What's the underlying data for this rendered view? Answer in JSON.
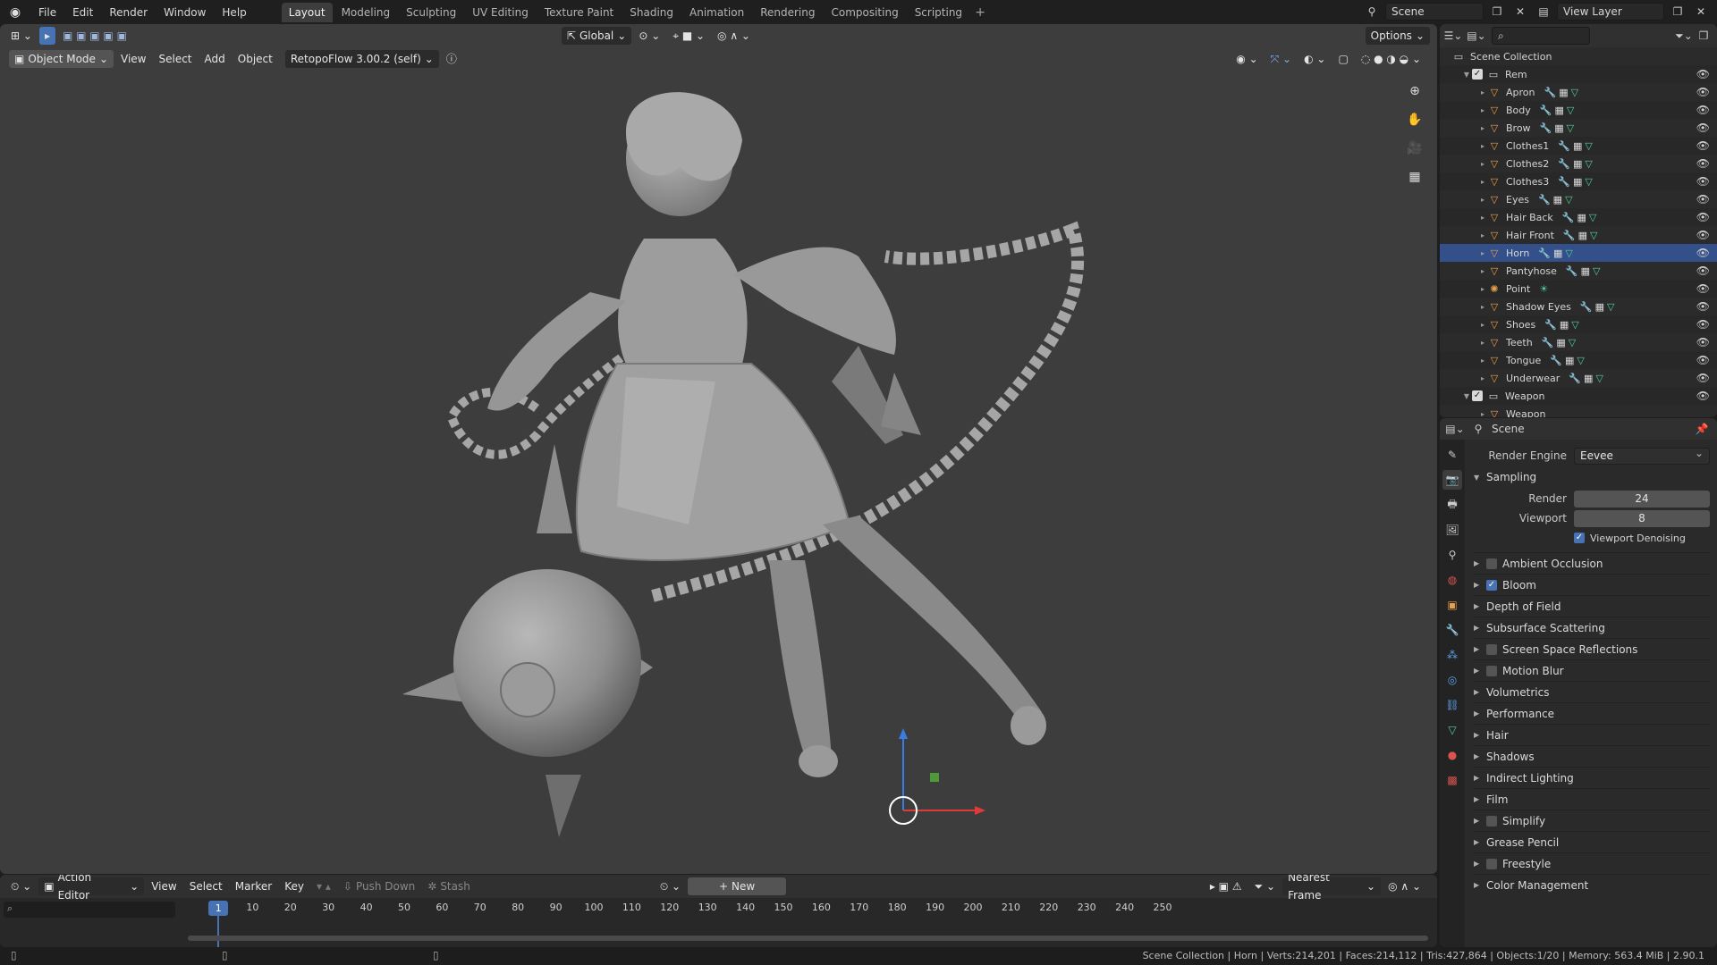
{
  "topbar": {
    "menus": [
      "File",
      "Edit",
      "Render",
      "Window",
      "Help"
    ],
    "workspaces": [
      "Layout",
      "Modeling",
      "Sculpting",
      "UV Editing",
      "Texture Paint",
      "Shading",
      "Animation",
      "Rendering",
      "Compositing",
      "Scripting"
    ],
    "active_workspace": "Layout",
    "scene_name": "Scene",
    "view_layer": "View Layer"
  },
  "viewport": {
    "mode": "Object Mode",
    "menus": [
      "View",
      "Select",
      "Add",
      "Object"
    ],
    "addon": "RetopoFlow 3.00.2 (self)",
    "orientation": "Global",
    "options_label": "Options"
  },
  "outliner": {
    "root": "Scene Collection",
    "collection": "Rem",
    "objects": [
      {
        "name": "Apron",
        "type": "mesh"
      },
      {
        "name": "Body",
        "type": "mesh"
      },
      {
        "name": "Brow",
        "type": "mesh"
      },
      {
        "name": "Clothes1",
        "type": "mesh"
      },
      {
        "name": "Clothes2",
        "type": "mesh"
      },
      {
        "name": "Clothes3",
        "type": "mesh"
      },
      {
        "name": "Eyes",
        "type": "mesh"
      },
      {
        "name": "Hair Back",
        "type": "mesh"
      },
      {
        "name": "Hair Front",
        "type": "mesh"
      },
      {
        "name": "Horn",
        "type": "mesh",
        "selected": true
      },
      {
        "name": "Pantyhose",
        "type": "mesh"
      },
      {
        "name": "Point",
        "type": "light"
      },
      {
        "name": "Shadow Eyes",
        "type": "mesh"
      },
      {
        "name": "Shoes",
        "type": "mesh"
      },
      {
        "name": "Teeth",
        "type": "mesh"
      },
      {
        "name": "Tongue",
        "type": "mesh"
      },
      {
        "name": "Underwear",
        "type": "mesh"
      }
    ],
    "collection2": "Weapon",
    "collection2_child": "Weapon"
  },
  "properties": {
    "context": "Scene",
    "render_engine_label": "Render Engine",
    "render_engine": "Eevee",
    "sampling_label": "Sampling",
    "render_label": "Render",
    "render_samples": "24",
    "viewport_label": "Viewport",
    "viewport_samples": "8",
    "viewport_denoising": "Viewport Denoising",
    "panels": [
      {
        "label": "Ambient Occlusion",
        "checkbox": true,
        "checked": false
      },
      {
        "label": "Bloom",
        "checkbox": true,
        "checked": true
      },
      {
        "label": "Depth of Field",
        "checkbox": false
      },
      {
        "label": "Subsurface Scattering",
        "checkbox": false
      },
      {
        "label": "Screen Space Reflections",
        "checkbox": true,
        "checked": false
      },
      {
        "label": "Motion Blur",
        "checkbox": true,
        "checked": false
      },
      {
        "label": "Volumetrics",
        "checkbox": false
      },
      {
        "label": "Performance",
        "checkbox": false
      },
      {
        "label": "Hair",
        "checkbox": false
      },
      {
        "label": "Shadows",
        "checkbox": false
      },
      {
        "label": "Indirect Lighting",
        "checkbox": false
      },
      {
        "label": "Film",
        "checkbox": false
      },
      {
        "label": "Simplify",
        "checkbox": true,
        "checked": false
      },
      {
        "label": "Grease Pencil",
        "checkbox": false
      },
      {
        "label": "Freestyle",
        "checkbox": true,
        "checked": false
      },
      {
        "label": "Color Management",
        "checkbox": false
      }
    ]
  },
  "timeline": {
    "editor": "Action Editor",
    "menus": [
      "View",
      "Select",
      "Marker",
      "Key"
    ],
    "push_down": "Push Down",
    "stash": "Stash",
    "new_label": "New",
    "snap": "Nearest Frame",
    "current_frame": "1",
    "ticks": [
      "10",
      "20",
      "30",
      "40",
      "50",
      "60",
      "70",
      "80",
      "90",
      "100",
      "110",
      "120",
      "130",
      "140",
      "150",
      "160",
      "170",
      "180",
      "190",
      "200",
      "210",
      "220",
      "230",
      "240",
      "250"
    ]
  },
  "statusbar": {
    "text": "Scene Collection | Horn | Verts:214,201 | Faces:214,112 | Tris:427,864 | Objects:1/20 | Memory: 563.4 MiB | 2.90.1"
  },
  "colors": {
    "accent": "#4772b3",
    "selected_row": "#33508a",
    "mesh_icon": "#e8a04a",
    "viewport_bg": "#3d3d3d"
  }
}
